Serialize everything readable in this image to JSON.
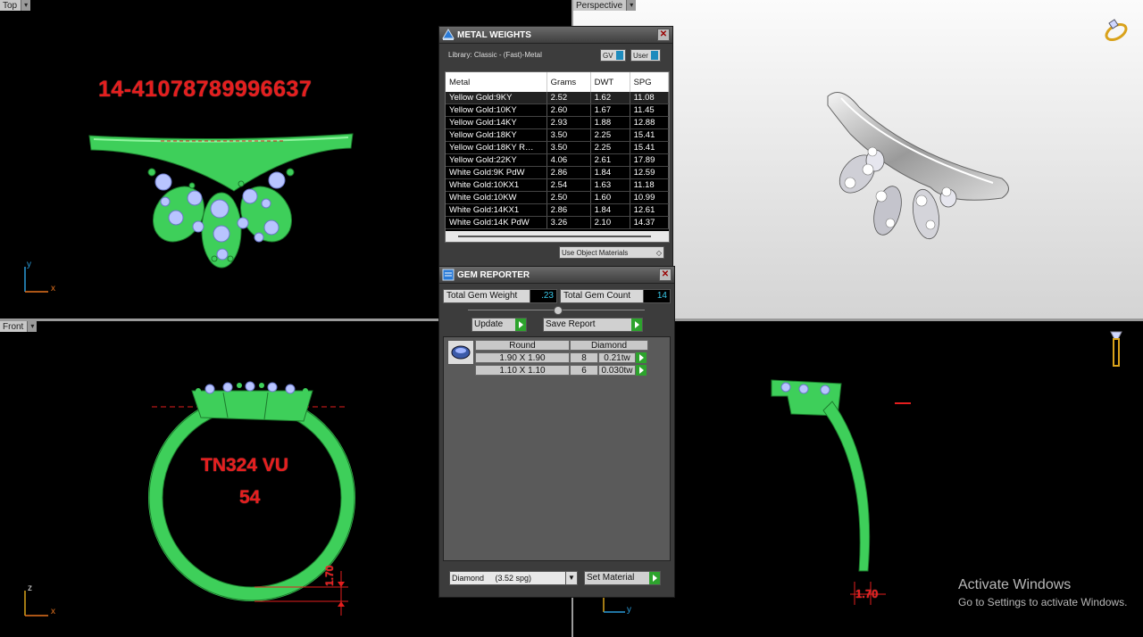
{
  "viewports": {
    "top": {
      "label": "Top"
    },
    "perspective": {
      "label": "Perspective"
    },
    "front": {
      "label": "Front"
    }
  },
  "annotations": {
    "top_code": "14-41078789996637",
    "front_line1": "TN324 VU",
    "front_line2": "54",
    "dim_front": "1.70",
    "dim_right": "1.70"
  },
  "axes": {
    "top_v": "y",
    "top_h": "x",
    "front_v": "z",
    "front_h": "x",
    "right_h": "y"
  },
  "metal_weights": {
    "title": "METAL WEIGHTS",
    "library": "Library: Classic - (Fast)-Metal",
    "gv_label": "GV",
    "user_label": "User",
    "columns": [
      "Metal",
      "Grams",
      "DWT",
      "SPG"
    ],
    "rows": [
      [
        "Yellow Gold:9KY",
        "2.52",
        "1.62",
        "11.08"
      ],
      [
        "Yellow Gold:10KY",
        "2.60",
        "1.67",
        "11.45"
      ],
      [
        "Yellow Gold:14KY",
        "2.93",
        "1.88",
        "12.88"
      ],
      [
        "Yellow Gold:18KY",
        "3.50",
        "2.25",
        "15.41"
      ],
      [
        "Yellow Gold:18KY R…",
        "3.50",
        "2.25",
        "15.41"
      ],
      [
        "Yellow Gold:22KY",
        "4.06",
        "2.61",
        "17.89"
      ],
      [
        "White Gold:9K PdW",
        "2.86",
        "1.84",
        "12.59"
      ],
      [
        "White Gold:10KX1",
        "2.54",
        "1.63",
        "11.18"
      ],
      [
        "White Gold:10KW",
        "2.50",
        "1.60",
        "10.99"
      ],
      [
        "White Gold:14KX1",
        "2.86",
        "1.84",
        "12.61"
      ],
      [
        "White Gold:14K PdW",
        "3.26",
        "2.10",
        "14.37"
      ]
    ],
    "use_object_materials": "Use Object Materials"
  },
  "gem_reporter": {
    "title": "GEM REPORTER",
    "total_weight_label": "Total Gem Weight",
    "total_weight_value": ".23",
    "total_count_label": "Total Gem Count",
    "total_count_value": "14",
    "update_label": "Update",
    "save_report_label": "Save Report",
    "shape": "Round",
    "material": "Diamond",
    "rows": [
      {
        "size": "1.90 X 1.90",
        "count": "8",
        "weight": "0.21tw"
      },
      {
        "size": "1.10 X 1.10",
        "count": "6",
        "weight": "0.030tw"
      }
    ],
    "material_select": "Diamond     (3.52 spg)",
    "set_material_label": "Set Material"
  },
  "watermark": {
    "line1": "Activate Windows",
    "line2": "Go to Settings to activate Windows."
  },
  "colors": {
    "model_green": "#3ecf5a",
    "gem_blue": "#b8c4ff",
    "annotation_red": "#e51e1e",
    "accent_blue": "#38c7e8",
    "button_green": "#2da32d"
  }
}
